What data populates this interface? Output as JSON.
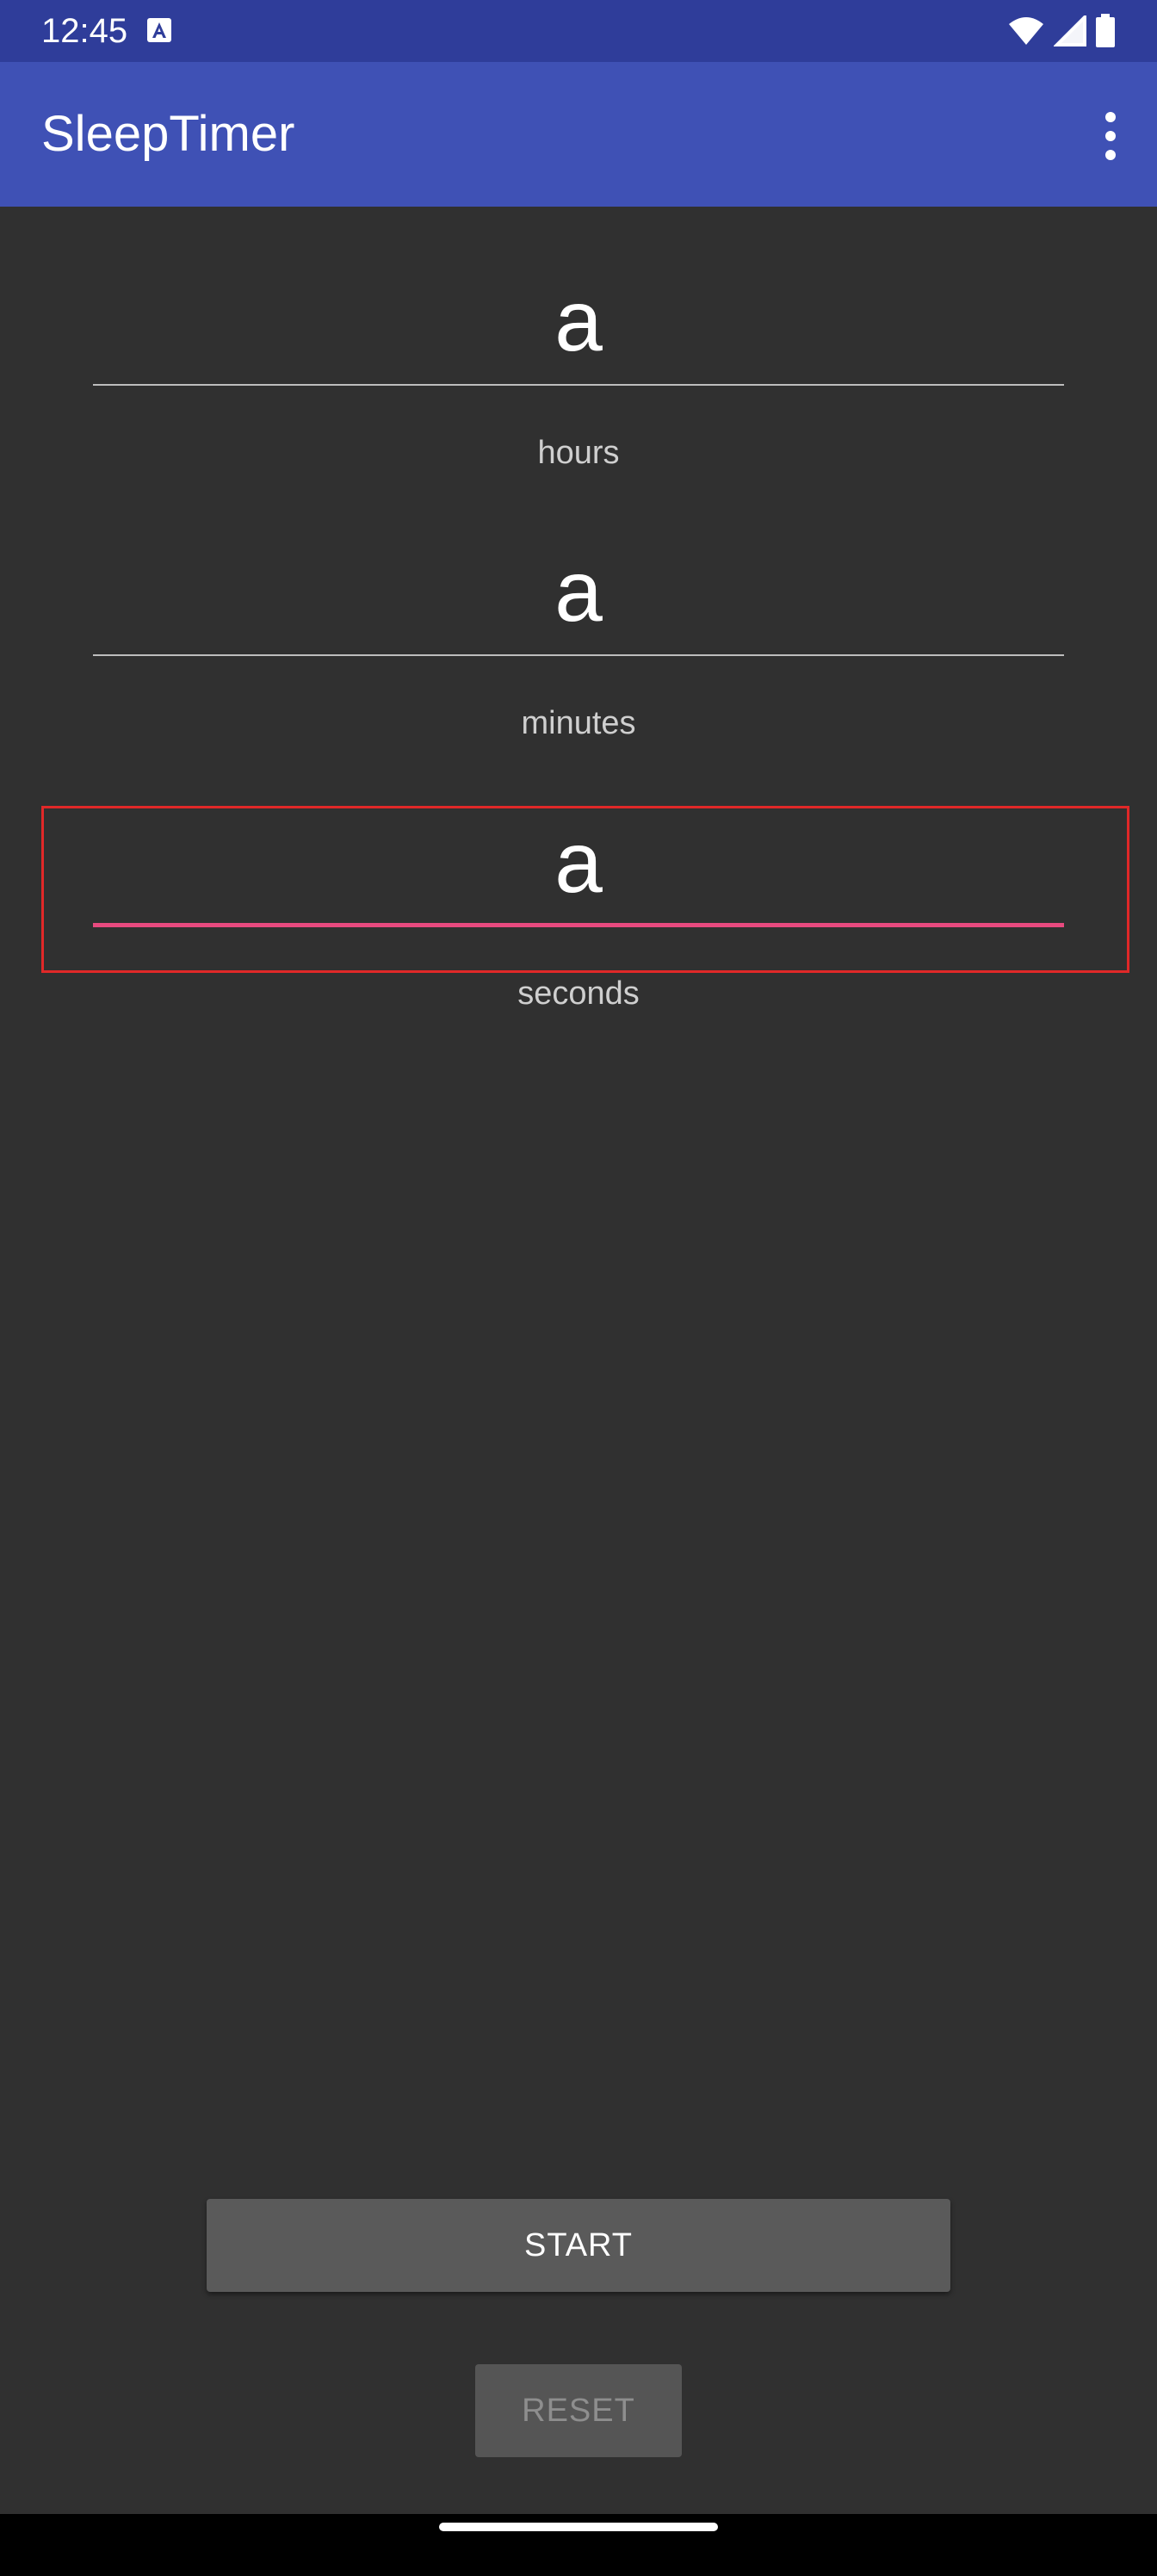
{
  "status_bar": {
    "time": "12:45",
    "icons": [
      "keyboard-a-icon",
      "wifi-icon",
      "signal-icon",
      "battery-icon"
    ]
  },
  "app_bar": {
    "title": "SleepTimer",
    "menu_icon": "more-vert-icon"
  },
  "fields": {
    "hours": {
      "value": "a",
      "label": "hours"
    },
    "minutes": {
      "value": "a",
      "label": "minutes"
    },
    "seconds": {
      "value": "a",
      "label": "seconds",
      "focused": true
    }
  },
  "buttons": {
    "start_label": "START",
    "reset_label": "RESET"
  },
  "colors": {
    "status_bar": "#2f3d9a",
    "app_bar": "#3f51b5",
    "background": "#303030",
    "focus_accent": "#e84a7f",
    "highlight_box": "#e02828"
  }
}
